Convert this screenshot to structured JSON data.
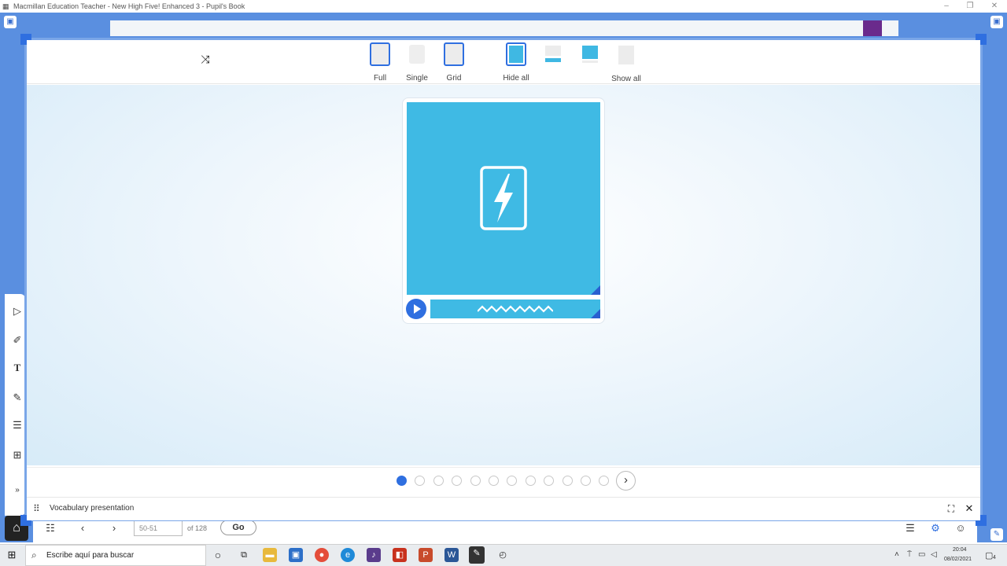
{
  "window": {
    "title": "Macmillan Education Teacher - New High Five! Enhanced 3 - Pupil's Book",
    "minimize": "–",
    "maximize": "❐",
    "close": "✕"
  },
  "view_modes": [
    {
      "label": "Full",
      "active": true
    },
    {
      "label": "Single",
      "active": false
    },
    {
      "label": "Grid",
      "active": true
    }
  ],
  "reveal_options": {
    "hide_all_label": "Hide all",
    "show_all_label": "Show all"
  },
  "pagination": {
    "total_dots": 12,
    "current": 1
  },
  "modal": {
    "footer_title": "Vocabulary presentation"
  },
  "page_nav": {
    "page_input_value": "50-51",
    "of_label": "of 128",
    "go_label": "Go"
  },
  "taskbar": {
    "search_placeholder": "Escribe aquí para buscar",
    "time": "20:04",
    "date": "08/02/2021",
    "notifications": "4"
  },
  "colors": {
    "accent_blue": "#2f6fe0",
    "card_cyan": "#3fbae4",
    "app_bg": "#5a8fe0"
  }
}
